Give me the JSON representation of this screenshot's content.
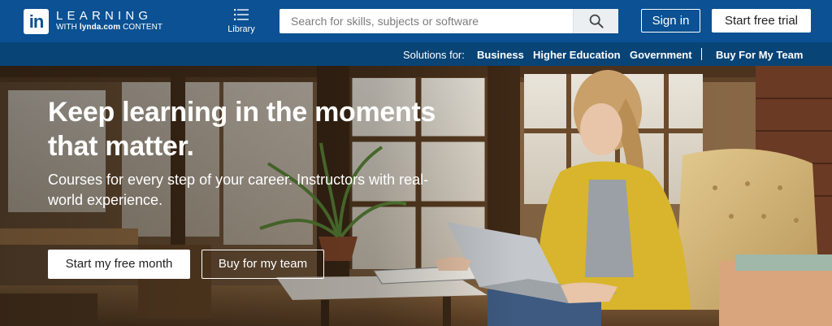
{
  "header": {
    "logo": {
      "in": "in",
      "title": "LEARNING",
      "subtitle_pre": "WITH",
      "subtitle_brand": "lynda.com",
      "subtitle_post": "CONTENT"
    },
    "library_label": "Library",
    "search": {
      "placeholder": "Search for skills, subjects or software",
      "value": ""
    },
    "signin_label": "Sign in",
    "trial_label": "Start free trial"
  },
  "solutions": {
    "label": "Solutions for:",
    "links": [
      "Business",
      "Higher Education",
      "Government"
    ],
    "team_link": "Buy For My Team"
  },
  "hero": {
    "headline_line1": "Keep learning in the moments",
    "headline_line2": "that matter.",
    "subline_line1": "Courses for every step of your career. Instructors with real-",
    "subline_line2": "world experience.",
    "primary_button": "Start my free month",
    "secondary_button": "Buy for my team"
  },
  "colors": {
    "header_bg": "#0b5193",
    "solutions_bg": "#094477",
    "jacket_yellow": "#d8b52c"
  },
  "icons": {
    "library": "library-list-icon",
    "search": "search-icon",
    "logo": "linkedin-logo-icon"
  }
}
